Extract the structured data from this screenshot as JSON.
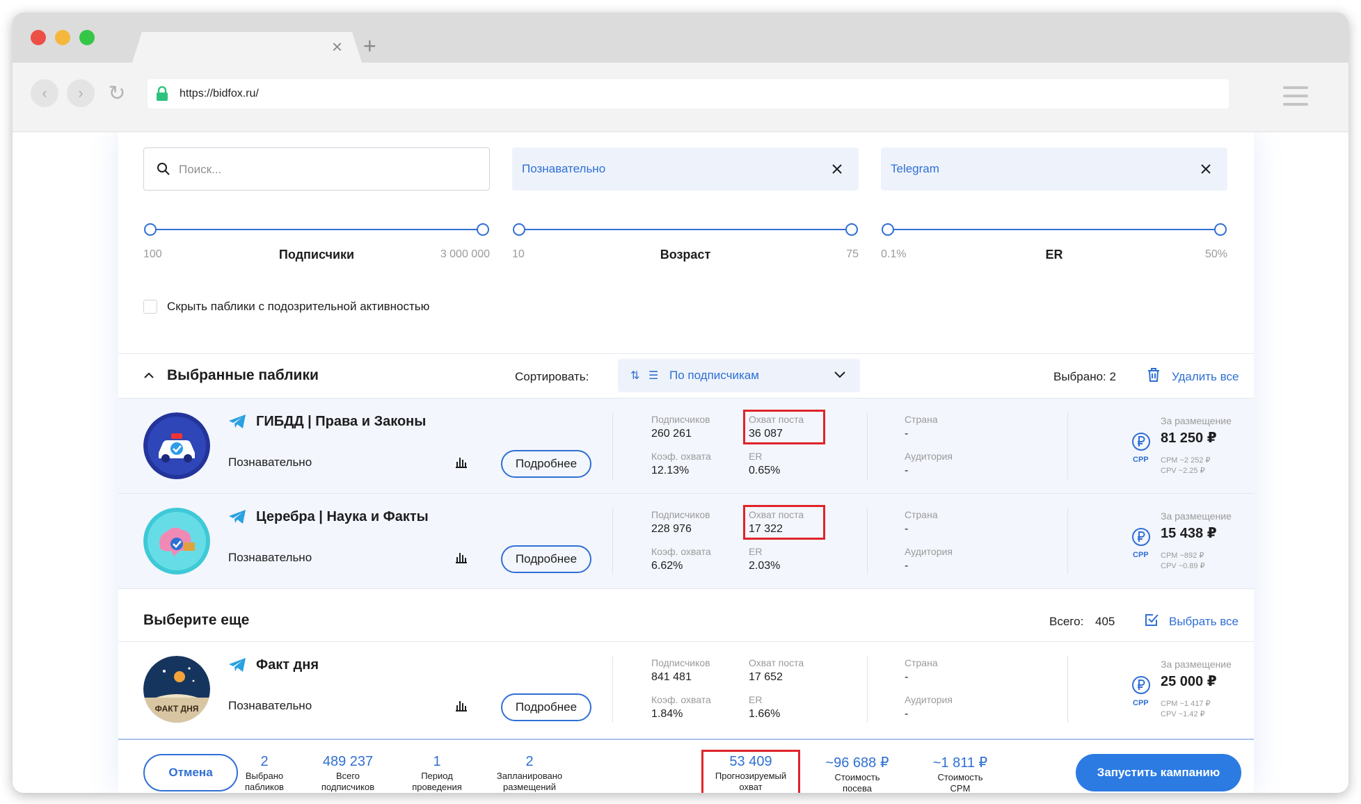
{
  "browser": {
    "url": "https://bidfox.ru/"
  },
  "filters": {
    "search_placeholder": "Поиск...",
    "chip_category": "Познавательно",
    "chip_platform": "Telegram",
    "ranges": [
      {
        "title": "Подписчики",
        "min": "100",
        "max": "3 000 000"
      },
      {
        "title": "Возраст",
        "min": "10",
        "max": "75"
      },
      {
        "title": "ER",
        "min": "0.1%",
        "max": "50%"
      }
    ],
    "hide_suspicious_label": "Скрыть паблики с подозрительной активностью",
    "hide_suspicious_checked": false
  },
  "selected": {
    "title": "Выбранные паблики",
    "sort_label": "Сортировать:",
    "sort_value": "По подписчикам",
    "selected_count": "Выбрано: 2",
    "delete_all": "Удалить все"
  },
  "labels": {
    "subscribers": "Подписчиков",
    "reach": "Охват поста",
    "reach_coef": "Коэф. охвата",
    "er": "ER",
    "country": "Страна",
    "audience": "Аудитория",
    "placement": "За размещение",
    "more_button": "Подробнее",
    "cpp": "CPP"
  },
  "selected_channels": [
    {
      "name": "ГИБДД | Права и Законы",
      "category": "Познавательно",
      "subscribers": "260 261",
      "reach": "36 087",
      "reach_coef": "12.13%",
      "er": "0.65%",
      "country": "-",
      "audience": "-",
      "price": "81 250 ₽",
      "cpm": "CPM ~2 252 ₽",
      "cpv": "CPV ~2.25 ₽"
    },
    {
      "name": "Церебра | Наука и Факты",
      "category": "Познавательно",
      "subscribers": "228 976",
      "reach": "17 322",
      "reach_coef": "6.62%",
      "er": "2.03%",
      "country": "-",
      "audience": "-",
      "price": "15 438 ₽",
      "cpm": "CPM ~892 ₽",
      "cpv": "CPV ~0.89 ₽"
    }
  ],
  "more": {
    "title": "Выберите еще",
    "total_label": "Всего:",
    "total_value": "405",
    "select_all": "Выбрать все"
  },
  "more_channels": [
    {
      "name": "Факт дня",
      "category": "Познавательно",
      "subscribers": "841 481",
      "reach": "17 652",
      "reach_coef": "1.84%",
      "er": "1.66%",
      "country": "-",
      "audience": "-",
      "price": "25 000 ₽",
      "cpm": "CPM ~1 417 ₽",
      "cpv": "CPV ~1.42 ₽",
      "avatar_text": "ФАКТ ДНЯ"
    }
  ],
  "footer": {
    "cancel": "Отмена",
    "items": [
      {
        "value": "2",
        "label1": "Выбрано",
        "label2": "пабликов"
      },
      {
        "value": "489 237",
        "label1": "Всего",
        "label2": "подписчиков"
      },
      {
        "value": "1",
        "label1": "Период",
        "label2": "проведения"
      },
      {
        "value": "2",
        "label1": "Запланировано",
        "label2": "размещений"
      },
      {
        "value": "53 409",
        "label1": "Прогнозируемый",
        "label2": "охват"
      },
      {
        "value": "~96 688 ₽",
        "label1": "Стоимость",
        "label2": "посева"
      },
      {
        "value": "~1 811 ₽",
        "label1": "Стоимость",
        "label2": "CPM"
      }
    ],
    "launch": "Запустить кампанию"
  },
  "colors": {
    "accent": "#2f6fd4",
    "button_blue": "#2b7be3",
    "highlight_red": "#e0232a",
    "selected_row_bg": "#f3f6fc"
  }
}
